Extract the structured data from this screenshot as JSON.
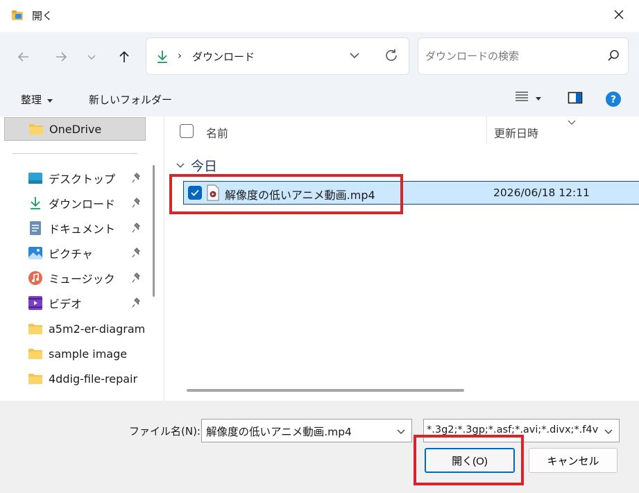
{
  "colors": {
    "accent": "#0067c0",
    "selection": "#cce8ff",
    "highlight_box": "#d9252a",
    "download_green": "#1a9b5c"
  },
  "window": {
    "title": "開く",
    "icon": "folder-app-icon",
    "close_icon": "close-icon"
  },
  "nav": {
    "back_icon": "arrow-left-icon",
    "forward_icon": "arrow-right-icon",
    "recent_icon": "chevron-down-icon",
    "up_icon": "arrow-up-icon",
    "address": {
      "icon": "download-icon",
      "separator": "›",
      "path": "ダウンロード",
      "dropdown_icon": "chevron-down-icon",
      "refresh_icon": "refresh-icon"
    },
    "search": {
      "placeholder": "ダウンロードの検索",
      "icon": "search-icon"
    }
  },
  "commandbar": {
    "organize_label": "整理",
    "new_folder_label": "新しいフォルダー",
    "view_icon": "list-view-icon",
    "preview_pane_icon": "preview-pane-icon",
    "help_icon": "help-icon",
    "help_glyph": "?"
  },
  "sidebar": {
    "onedrive": {
      "label": "OneDrive",
      "icon": "folder-icon"
    },
    "items": [
      {
        "label": "デスクトップ",
        "icon": "desktop-icon",
        "pinned": true
      },
      {
        "label": "ダウンロード",
        "icon": "download-icon",
        "pinned": true
      },
      {
        "label": "ドキュメント",
        "icon": "document-icon",
        "pinned": true
      },
      {
        "label": "ピクチャ",
        "icon": "pictures-icon",
        "pinned": true
      },
      {
        "label": "ミュージック",
        "icon": "music-icon",
        "pinned": true
      },
      {
        "label": "ビデオ",
        "icon": "video-icon",
        "pinned": true
      },
      {
        "label": "a5m2-er-diagram",
        "icon": "folder-icon",
        "pinned": false
      },
      {
        "label": "sample image",
        "icon": "folder-icon",
        "pinned": false
      },
      {
        "label": "4ddig-file-repair",
        "icon": "folder-icon",
        "pinned": false
      }
    ]
  },
  "filelist": {
    "columns": {
      "name": "名前",
      "date_modified": "更新日時"
    },
    "groups": [
      {
        "label": "今日",
        "files": [
          {
            "name": "解像度の低いアニメ動画.mp4",
            "date": "2026/06/18 12:11",
            "selected": true,
            "icon": "video-file-icon"
          }
        ]
      }
    ]
  },
  "footer": {
    "filename_label": "ファイル名(N):",
    "filename_value": "解像度の低いアニメ動画.mp4",
    "filetype_value": "*.3g2;*.3gp;*.asf;*.avi;*.divx;*.f4v",
    "open_label": "開く(O)",
    "cancel_label": "キャンセル"
  }
}
